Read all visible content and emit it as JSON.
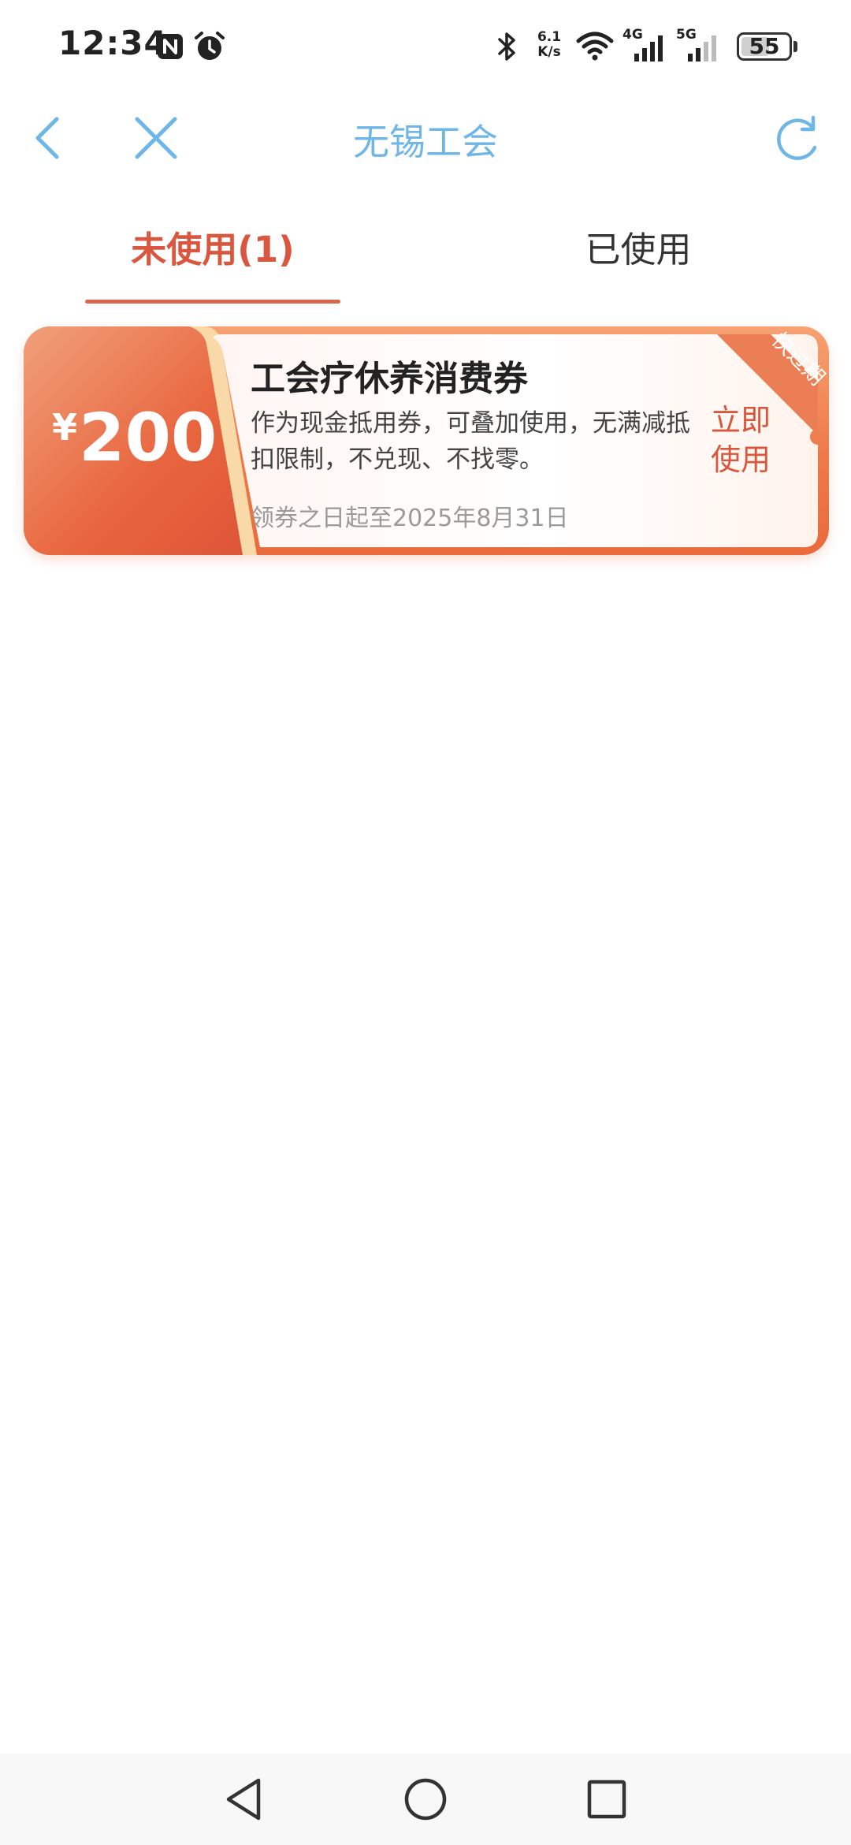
{
  "status_bar": {
    "time": "12:34",
    "net_speed_value": "6.1",
    "net_speed_unit": "K/s",
    "network_1": "4G",
    "network_2": "5G",
    "battery": "55"
  },
  "nav": {
    "title": "无锡工会",
    "accent_color": "#6db6e6"
  },
  "tabs": {
    "unused_label": "未使用(1)",
    "used_label": "已使用",
    "active_color": "#d9573e"
  },
  "coupons": [
    {
      "currency": "¥",
      "amount": "200",
      "title": "工会疗休养消费券",
      "description": "作为现金抵用券，可叠加使用，无满减抵扣限制，不兑现、不找零。",
      "validity": "领券之日起至2025年8月31日",
      "use_label_line1": "立即",
      "use_label_line2": "使用",
      "ribbon": "快过期"
    }
  ],
  "icons": {
    "status": [
      "nfc-icon",
      "alarm-icon",
      "bluetooth-icon",
      "wifi-icon",
      "signal-icon",
      "battery-icon"
    ],
    "nav": [
      "back-icon",
      "close-icon",
      "refresh-icon"
    ],
    "system": [
      "system-back-icon",
      "system-home-icon",
      "system-recents-icon"
    ]
  }
}
